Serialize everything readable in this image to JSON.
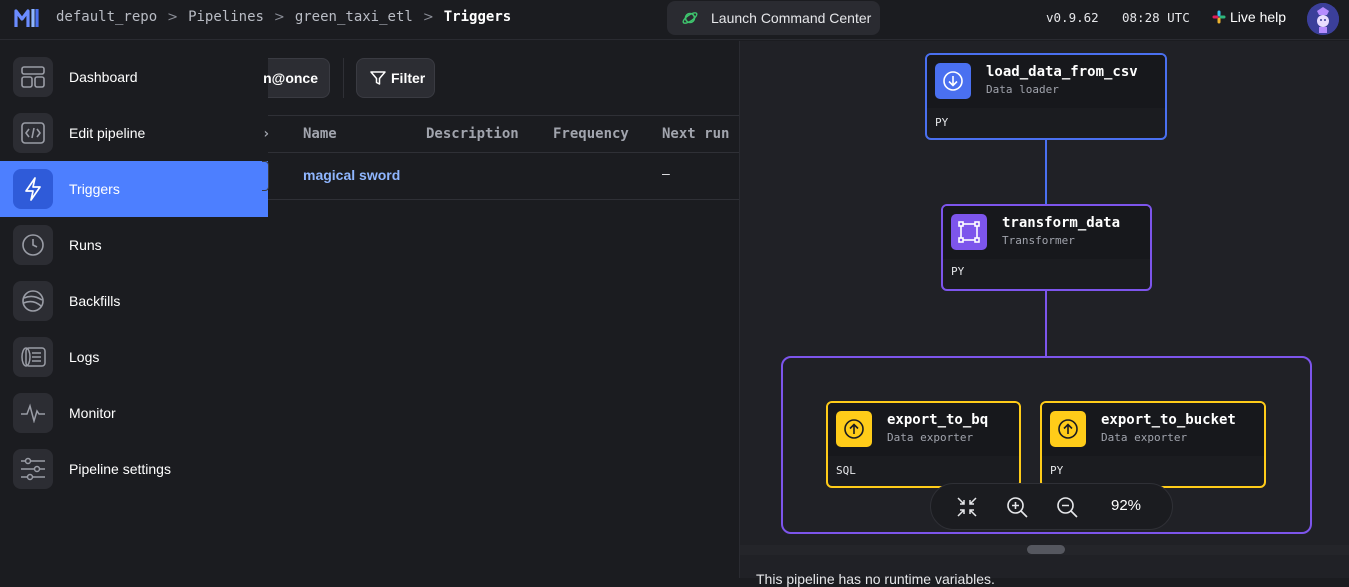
{
  "topbar": {
    "breadcrumb": [
      "default_repo",
      "Pipelines",
      "green_taxi_etl",
      "Triggers"
    ],
    "separator": ">",
    "launch_label": "Launch Command Center",
    "version": "v0.9.62",
    "time": "08:28 UTC",
    "live_help": "Live help"
  },
  "sidebar": {
    "items": [
      {
        "label": "Dashboard",
        "icon": "dashboard-icon"
      },
      {
        "label": "Edit pipeline",
        "icon": "code-icon"
      },
      {
        "label": "Triggers",
        "icon": "lightning-icon",
        "active": true
      },
      {
        "label": "Runs",
        "icon": "clock-icon"
      },
      {
        "label": "Backfills",
        "icon": "backfill-icon"
      },
      {
        "label": "Logs",
        "icon": "logs-icon"
      },
      {
        "label": "Monitor",
        "icon": "pulse-icon"
      },
      {
        "label": "Pipeline settings",
        "icon": "sliders-icon"
      }
    ]
  },
  "toolbar": {
    "run_once_label": "n@once",
    "filter_label": "Filter"
  },
  "table": {
    "columns": [
      "Name",
      "Description",
      "Frequency",
      "Next run"
    ],
    "rows": [
      {
        "name": "magical sword",
        "description": "",
        "frequency": "",
        "next_run": "–"
      }
    ]
  },
  "graph": {
    "blocks": [
      {
        "name": "load_data_from_csv",
        "type": "Data loader",
        "lang": "PY",
        "color": "#4a70f0"
      },
      {
        "name": "transform_data",
        "type": "Transformer",
        "lang": "PY",
        "color": "#7d55ec"
      },
      {
        "name": "export_to_bq",
        "type": "Data exporter",
        "lang": "SQL",
        "color": "#ffcc19"
      },
      {
        "name": "export_to_bucket",
        "type": "Data exporter",
        "lang": "PY",
        "color": "#ffcc19"
      }
    ],
    "zoom": "92%"
  },
  "variables_text": "This pipeline has no runtime variables."
}
